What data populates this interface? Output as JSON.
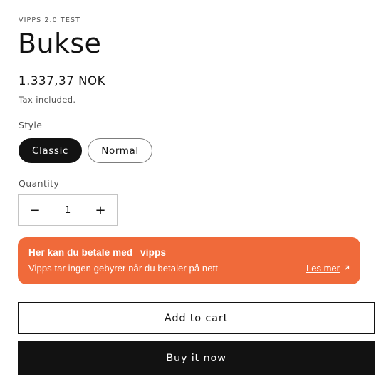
{
  "product": {
    "vendor": "VIPPS 2.0 TEST",
    "title": "Bukse",
    "price": "1.337,37 NOK",
    "tax_note": "Tax included."
  },
  "style_option": {
    "label": "Style",
    "options": [
      "Classic",
      "Normal"
    ],
    "selected": "Classic"
  },
  "quantity": {
    "label": "Quantity",
    "value": "1",
    "decrease_symbol": "−",
    "increase_symbol": "+"
  },
  "vipps_banner": {
    "title": "Her kan du betale med",
    "logo_text": "vipps",
    "subtitle": "Vipps tar ingen gebyrer når du betaler på nett",
    "link_label": "Les mer",
    "background_color": "#f06a3a"
  },
  "actions": {
    "add_to_cart": "Add to cart",
    "buy_now": "Buy it now"
  },
  "colors": {
    "primary": "#121212",
    "vipps_orange": "#f06a3a"
  }
}
